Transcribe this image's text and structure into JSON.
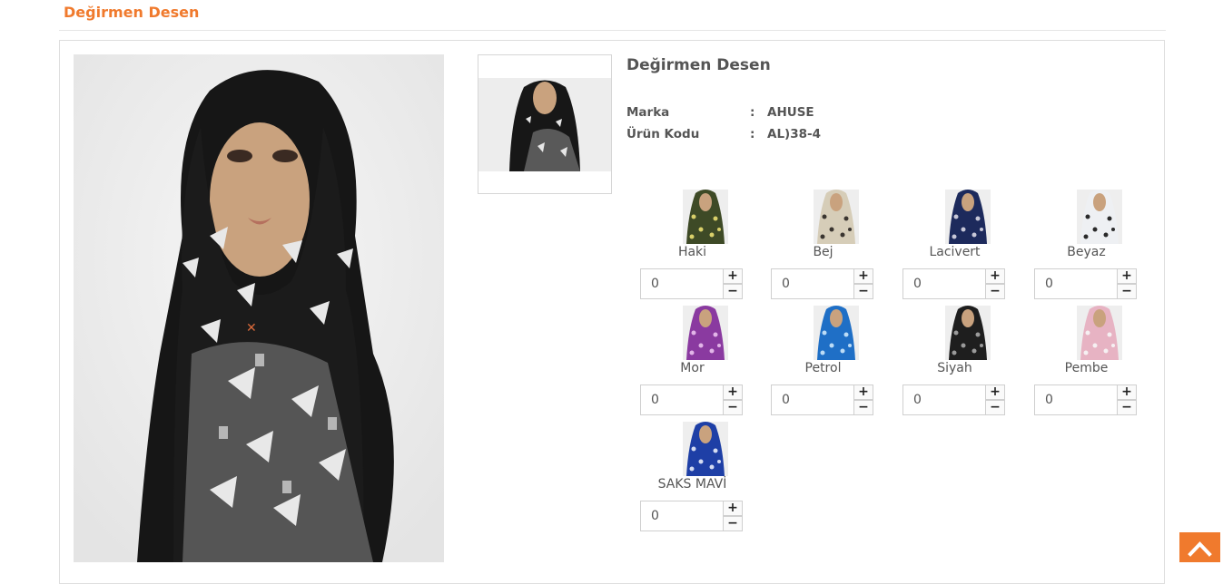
{
  "page": {
    "title": "Değirmen Desen"
  },
  "product": {
    "name": "Değirmen Desen",
    "specs": [
      {
        "label": "Marka",
        "separator": ":",
        "value": "AHUSE"
      },
      {
        "label": "Ürün Kodu",
        "separator": ":",
        "value": "AL)38-4"
      }
    ]
  },
  "variants": [
    {
      "name": "Haki",
      "qty": "0",
      "color": "#3e4a26",
      "pattern": "#d9d06a"
    },
    {
      "name": "Bej",
      "qty": "0",
      "color": "#d6cdb8",
      "pattern": "#3a3530"
    },
    {
      "name": "Lacivert",
      "qty": "0",
      "color": "#1d2a5c",
      "pattern": "#c8c8d8"
    },
    {
      "name": "Beyaz",
      "qty": "0",
      "color": "#eef0f3",
      "pattern": "#2a2a2a"
    },
    {
      "name": "Mor",
      "qty": "0",
      "color": "#8a3aa0",
      "pattern": "#e2b5e8"
    },
    {
      "name": "Petrol",
      "qty": "0",
      "color": "#1f6fc6",
      "pattern": "#bcdcf6"
    },
    {
      "name": "Siyah",
      "qty": "0",
      "color": "#1e1e1e",
      "pattern": "#9a9a9a"
    },
    {
      "name": "Pembe",
      "qty": "0",
      "color": "#e7b3c3",
      "pattern": "#f6f0f2"
    },
    {
      "name": "SAKS MAVİ",
      "qty": "0",
      "color": "#1e3fa6",
      "pattern": "#d4dcf2"
    }
  ],
  "qty_controls": {
    "plus": "+",
    "minus": "−"
  },
  "icons": {
    "scroll_top": "chevron-up-icon",
    "scroll_top_color": "#f07a2d"
  }
}
